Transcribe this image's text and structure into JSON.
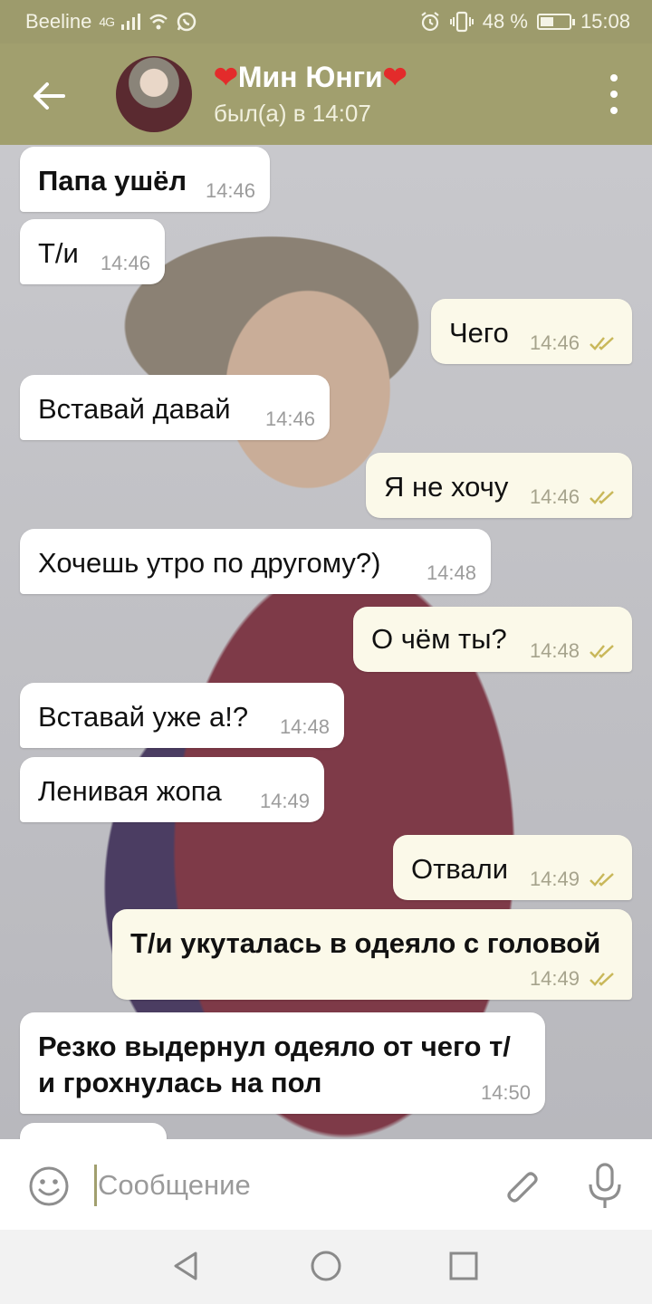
{
  "status_bar": {
    "carrier": "Beeline",
    "network": "4G",
    "battery": "48 %",
    "battery_level": 0.48,
    "time": "15:08"
  },
  "header": {
    "name": "Мин Юнги",
    "name_decoration": "❤",
    "status": "был(а) в 14:07"
  },
  "messages": [
    {
      "text": "Папа ушёл",
      "time": "14:46",
      "dir": "in"
    },
    {
      "text": "Т/и",
      "time": "14:46",
      "dir": "in"
    },
    {
      "text": "Чего",
      "time": "14:46",
      "dir": "out"
    },
    {
      "text": "Вставай давай",
      "time": "14:46",
      "dir": "in"
    },
    {
      "text": "Я не хочу",
      "time": "14:46",
      "dir": "out"
    },
    {
      "text": "Хочешь утро по другому?)",
      "time": "14:48",
      "dir": "in"
    },
    {
      "text": "О чём ты?",
      "time": "14:48",
      "dir": "out"
    },
    {
      "text": "Вставай уже а!?",
      "time": "14:48",
      "dir": "in"
    },
    {
      "text": "Ленивая жопа",
      "time": "14:49",
      "dir": "in"
    },
    {
      "text": "Отвали",
      "time": "14:49",
      "dir": "out"
    },
    {
      "text": "Т/и укуталась в одеяло с головой",
      "time": "14:49",
      "dir": "out"
    },
    {
      "text": "Резко выдернул одеяло от чего т/\nи грохнулась на пол",
      "time": "14:50",
      "dir": "in"
    }
  ],
  "input": {
    "placeholder": "Сообщение"
  },
  "colors": {
    "header": "#a19f6e",
    "status_bar": "#9d9b6c",
    "outgoing_bubble": "#fbf9e9",
    "incoming_bubble": "#ffffff",
    "read_tick": "#c9b85a"
  },
  "icons": {
    "back": "arrow-left-icon",
    "menu": "more-vertical-icon",
    "emoji": "smiley-icon",
    "attach": "paperclip-icon",
    "mic": "microphone-icon",
    "scroll": "chevron-down-icon",
    "read": "double-check-icon"
  }
}
